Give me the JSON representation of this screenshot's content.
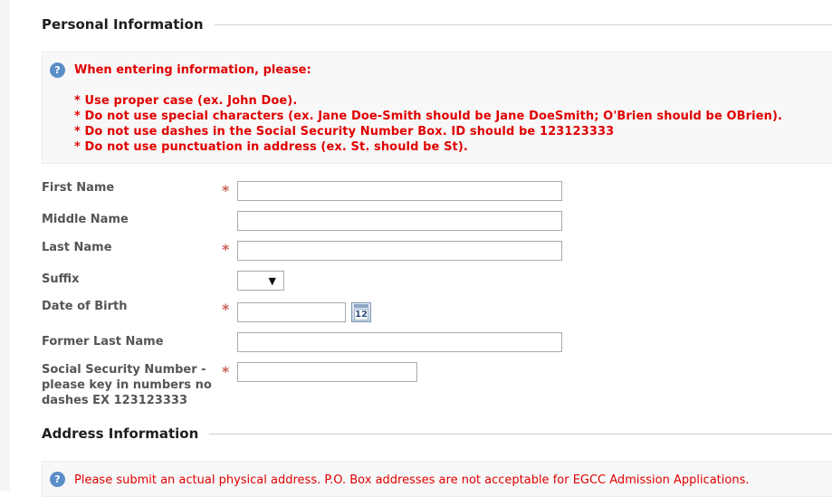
{
  "personal_section": {
    "title": "Personal Information"
  },
  "personal_notice": {
    "icon": "info-icon",
    "heading": "When entering information, please:",
    "rules": [
      "* Use proper case (ex. John Doe).",
      "* Do not use special characters (ex. Jane Doe-Smith should be Jane DoeSmith; O'Brien should be OBrien).",
      "* Do not use dashes in the Social Security Number Box. ID should be 123123333",
      "* Do not use punctuation in address (ex. St. should be St)."
    ]
  },
  "fields": {
    "first_name": {
      "label": "First Name",
      "required": "*",
      "value": ""
    },
    "middle_name": {
      "label": "Middle Name",
      "value": ""
    },
    "last_name": {
      "label": "Last Name",
      "required": "*",
      "value": ""
    },
    "suffix": {
      "label": "Suffix",
      "selected": "",
      "arrow": "▼"
    },
    "dob": {
      "label": "Date of Birth",
      "required": "*",
      "value": "",
      "calendar_text": "12"
    },
    "former_last_name": {
      "label": "Former Last Name",
      "value": ""
    },
    "ssn": {
      "label_lines": [
        "Social Security Number -",
        "please key in numbers no",
        "dashes EX 123123333"
      ],
      "required": "*",
      "value": ""
    }
  },
  "address_section": {
    "title": "Address Information"
  },
  "address_notice": {
    "icon": "info-icon",
    "text": "Please submit an actual physical address. P.O. Box addresses are not acceptable for EGCC Admission Applications."
  },
  "colors": {
    "warning_red": "#e00000",
    "required_star": "#c9655d",
    "info_blue": "#5b8ec9"
  }
}
